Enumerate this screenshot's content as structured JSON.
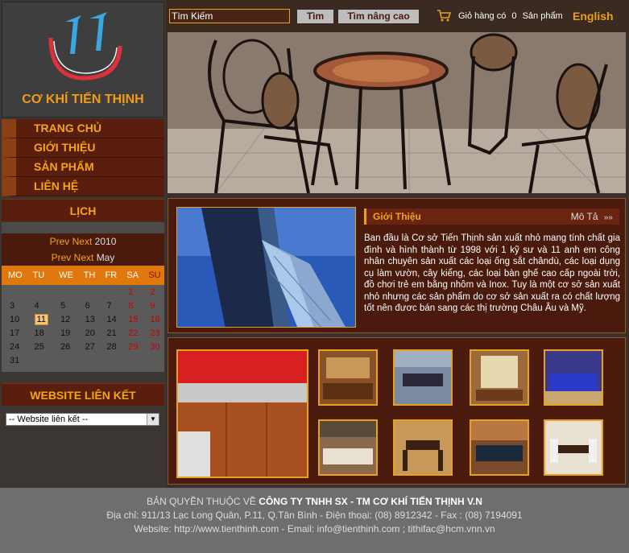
{
  "brand": {
    "name": "CƠ KHÍ TIẾN THỊNH",
    "logo_text": "TT"
  },
  "nav": [
    {
      "label": "TRANG CHỦ"
    },
    {
      "label": "GIỚI THIỆU"
    },
    {
      "label": "SẢN PHẨM"
    },
    {
      "label": "LIÊN HỆ"
    }
  ],
  "calendar": {
    "title": "LỊCH",
    "prev": "Prev",
    "next": "Next",
    "year": "2010",
    "month": "May",
    "weekdays": [
      "MO",
      "TU",
      "WE",
      "TH",
      "FR",
      "SA",
      "SU"
    ],
    "weeks": [
      [
        "",
        "",
        "",
        "",
        "",
        "1",
        "2"
      ],
      [
        "3",
        "4",
        "5",
        "6",
        "7",
        "8",
        "9"
      ],
      [
        "10",
        "11",
        "12",
        "13",
        "14",
        "15",
        "16"
      ],
      [
        "17",
        "18",
        "19",
        "20",
        "21",
        "22",
        "23"
      ],
      [
        "24",
        "25",
        "26",
        "27",
        "28",
        "29",
        "30"
      ],
      [
        "31",
        "",
        "",
        "",
        "",
        "",
        ""
      ]
    ],
    "today": "11"
  },
  "links": {
    "title": "WEBSITE LIÊN KẾT",
    "selected": "-- Website liên kết --"
  },
  "topbar": {
    "search_value": "Tìm Kiếm",
    "search_button": "Tìm",
    "advanced_button": "Tìm nâng cao",
    "cart_prefix": "Giỏ hàng có",
    "cart_count": "0",
    "cart_suffix": "Sản phẩm",
    "language": "English"
  },
  "intro": {
    "title": "Giới Thiệu",
    "more": "Mô Tả",
    "text": "Ban đầu là Cơ sở Tiến Thịnh sản xuất nhỏ mang tính chất gia đình và hình thành từ 1998 với 1 kỹ sư và 11 anh em công nhân chuyên sản xuất các loại ống sắt chândù, các loại dụng cụ làm vườn, cây kiểng, các loại bàn ghế cao cấp ngoài trời, đồ chơi trẻ em bằng nhôm và Inox. Tuy là một cơ sở sản xuất nhỏ nhưng các sản phẩm do cơ sở sản xuất ra có chất lượng tốt nên đươc bán sang các thị trường Châu Âu và Mỹ."
  },
  "footer": {
    "copyright_prefix": "BẢN QUYỀN THUỘC VỀ",
    "company": "CÔNG TY TNHH SX - TM CƠ KHÍ TIẾN THỊNH V.N",
    "address": "Địa chỉ: 911/13 Lạc Long Quân, P.11, Q.Tân Bình - Điện thoại: (08) 8912342 - Fax : (08) 7194091",
    "contact": "Website: http://www.tienthinh.com - Email: info@tienthinh.com ; tithifac@hcm.vnn.vn"
  },
  "colors": {
    "accent": "#f3a31e",
    "panel": "#4a1a0c",
    "nav": "#5a1e0e",
    "footer": "#6e6e6e"
  },
  "icons": [
    "cart-icon",
    "double-chevron-right-icon",
    "dropdown-arrow-icon"
  ]
}
